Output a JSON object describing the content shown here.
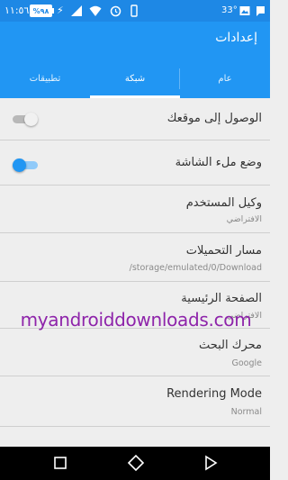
{
  "status_bar": {
    "time": "١١:٥٦",
    "battery": "%٩٨",
    "temperature": "33°"
  },
  "app_bar": {
    "title": "إعدادات"
  },
  "tabs": [
    {
      "label": "عام",
      "selected": false
    },
    {
      "label": "شبكة",
      "selected": true
    },
    {
      "label": "تطبيقات",
      "selected": false
    }
  ],
  "settings": [
    {
      "title": "الوصول إلى موقعك",
      "summary": "",
      "switch": "off"
    },
    {
      "title": "وضع ملء الشاشة",
      "summary": "",
      "switch": "on"
    },
    {
      "title": "وكيل المستخدم",
      "summary": "الافتراضي"
    },
    {
      "title": "مسار التحميلات",
      "summary": "/storage/emulated/0/Download"
    },
    {
      "title": "الصفحة الرئيسية",
      "summary": "الافتراضي"
    },
    {
      "title": "محرك البحث",
      "summary": "Google"
    },
    {
      "title": "Rendering Mode",
      "summary": "Normal"
    }
  ],
  "watermark": "myandroiddownloads.com",
  "colors": {
    "primary": "#2196f3",
    "status_bar": "#1e88e5",
    "background": "#eeeeee",
    "watermark": "#8e24aa"
  },
  "icons": {
    "status": [
      "battery-icon",
      "charging-icon",
      "signal-icon",
      "wifi-icon",
      "alarm-icon",
      "vibrate-icon",
      "image-icon",
      "message-icon"
    ],
    "nav": [
      "recents-icon",
      "home-icon",
      "back-icon"
    ]
  }
}
